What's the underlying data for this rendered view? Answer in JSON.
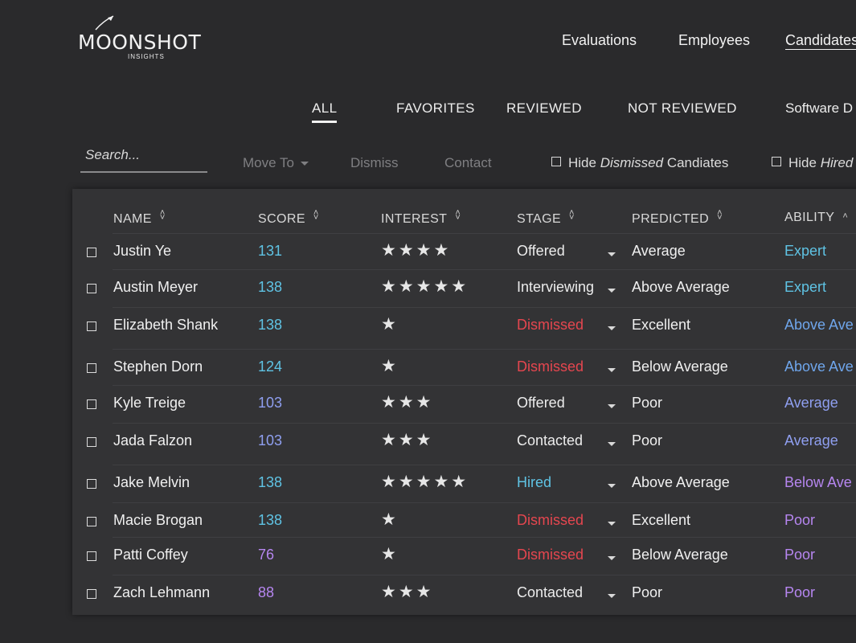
{
  "brand": {
    "name": "MOONSHOT",
    "sub": "INSIGHTS"
  },
  "nav": {
    "items": [
      "Evaluations",
      "Employees",
      "Candidates"
    ],
    "active": 2
  },
  "filters": {
    "tabs": [
      "ALL",
      "FAVORITES",
      "REVIEWED",
      "NOT REVIEWED",
      "Software D"
    ],
    "active": 0
  },
  "toolbar": {
    "search_placeholder": "Search...",
    "move_to": "Move To",
    "dismiss": "Dismiss",
    "contact": "Contact",
    "hide_dismissed_pre": "Hide ",
    "hide_dismissed_em": "Dismissed",
    "hide_dismissed_post": " Candiates",
    "hide_hired_pre": "Hide ",
    "hide_hired_em": "Hired"
  },
  "table": {
    "headers": {
      "name": "NAME",
      "score": "SCORE",
      "interest": "INTEREST",
      "stage": "STAGE",
      "predicted": "PREDICTED",
      "ability": "ABILITY"
    },
    "rows": [
      {
        "name": "Justin Ye",
        "score": "131",
        "stars": "★★★★",
        "stage": "Offered",
        "predicted": "Average",
        "ability": "Expert"
      },
      {
        "name": "Austin Meyer",
        "score": "138",
        "stars": "★★★★★",
        "stage": "Interviewing",
        "predicted": "Above Average",
        "ability": "Expert"
      },
      {
        "name": "Elizabeth Shank",
        "score": "138",
        "stars": "★",
        "stage": "Dismissed",
        "predicted": "Excellent",
        "ability": "Above Ave"
      },
      {
        "name": "Stephen Dorn",
        "score": "124",
        "stars": "★",
        "stage": "Dismissed",
        "predicted": "Below Average",
        "ability": "Above Ave"
      },
      {
        "name": "Kyle Treige",
        "score": "103",
        "stars": "★★★",
        "stage": "Offered",
        "predicted": "Poor",
        "ability": "Average"
      },
      {
        "name": "Jada Falzon",
        "score": "103",
        "stars": "★★★",
        "stage": "Contacted",
        "predicted": "Poor",
        "ability": "Average"
      },
      {
        "name": "Jake Melvin",
        "score": "138",
        "stars": "★★★★★",
        "stage": "Hired",
        "predicted": "Above Average",
        "ability": "Below Ave"
      },
      {
        "name": "Macie Brogan",
        "score": "138",
        "stars": "★",
        "stage": "Dismissed",
        "predicted": "Excellent",
        "ability": "Poor"
      },
      {
        "name": "Patti Coffey",
        "score": "76",
        "stars": "★",
        "stage": "Dismissed",
        "predicted": "Below Average",
        "ability": "Poor"
      },
      {
        "name": "Zach Lehmann",
        "score": "88",
        "stars": "★★★",
        "stage": "Contacted",
        "predicted": "Poor",
        "ability": "Poor"
      }
    ]
  },
  "colors": {
    "score_high": "#5fc3e4",
    "score_mid": "#8f9ff0",
    "score_low": "#b686f0",
    "dismissed": "#e5464f",
    "hired": "#5fc3e4",
    "neutral": "#ececec",
    "ability_expert": "#5fc3e4",
    "ability_above": "#6fa6ec",
    "ability_average": "#8f9ff0",
    "ability_low": "#b686f0"
  }
}
